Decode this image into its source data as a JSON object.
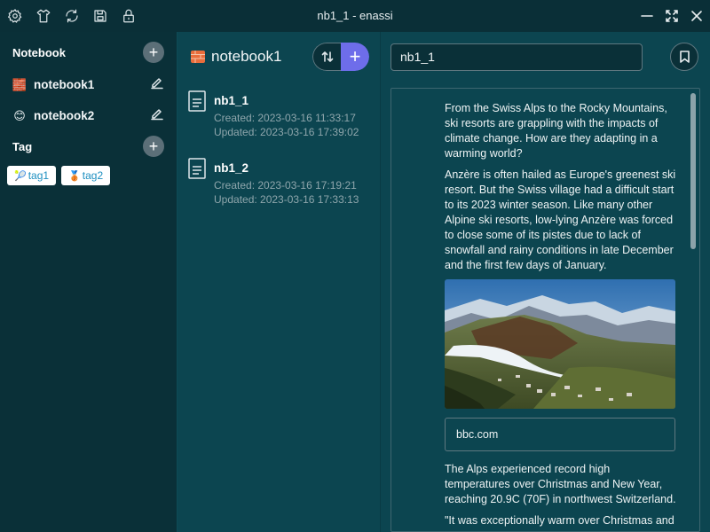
{
  "window": {
    "title": "nb1_1 - enassi"
  },
  "toolbar_icons": [
    "gear-icon",
    "shirt-icon",
    "refresh-icon",
    "save-icon",
    "lock-icon"
  ],
  "window_controls": [
    "minimize-icon",
    "fullscreen-icon",
    "close-icon"
  ],
  "sidebar": {
    "notebook_heading": "Notebook",
    "notebooks": [
      {
        "label": "notebook1",
        "emoji": "🧱"
      },
      {
        "label": "notebook2",
        "emoji": "😊"
      }
    ],
    "tag_heading": "Tag",
    "tags": [
      {
        "label": "tag1",
        "emoji": "🎾"
      },
      {
        "label": "tag2",
        "emoji": "🥉"
      }
    ]
  },
  "notelist": {
    "title": "notebook1",
    "title_emoji": "🧱",
    "notes": [
      {
        "title": "nb1_1",
        "created": "Created: 2023-03-16 11:33:17",
        "updated": "Updated: 2023-03-16 17:39:02"
      },
      {
        "title": "nb1_2",
        "created": "Created: 2023-03-16 17:19:21",
        "updated": "Updated: 2023-03-16 17:33:13"
      }
    ]
  },
  "editor": {
    "title_value": "nb1_1",
    "paragraphs": [
      "From the Swiss Alps to the Rocky Mountains, ski resorts are grappling with the impacts of climate change. How are they adapting in a warming world?",
      "Anzère is often hailed as Europe's greenest ski resort. But the Swiss village had a difficult start to its 2023 winter season. Like many other Alpine ski resorts, low-lying Anzère was forced to close some of its pistes due to lack of snowfall and rainy conditions in late December and the first few days of January."
    ],
    "link_card": "bbc.com",
    "after_paragraphs": [
      "The Alps experienced record high temperatures over Christmas and New Year, reaching 20.9C (70F) in northwest Switzerland.",
      "\"It was exceptionally warm over Christmas and"
    ]
  }
}
